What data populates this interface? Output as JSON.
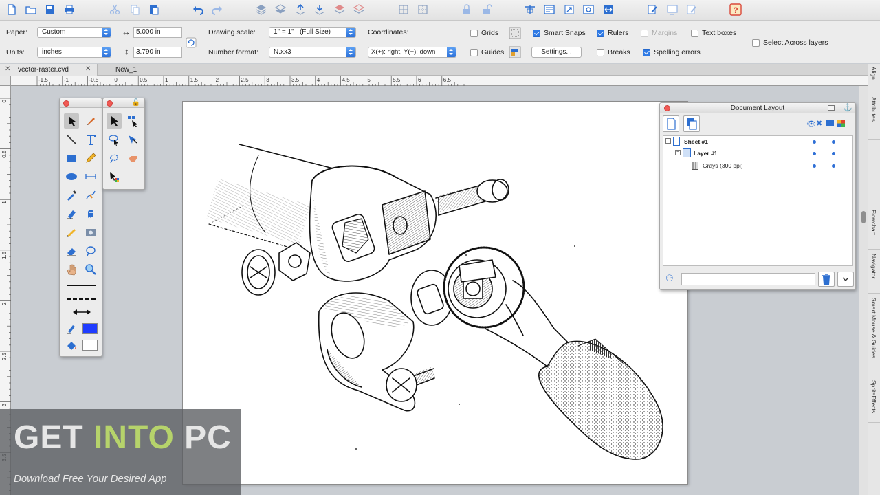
{
  "properties": {
    "paper_label": "Paper:",
    "paper_value": "Custom",
    "units_label": "Units:",
    "units_value": "inches",
    "width_value": "5.000 in",
    "height_value": "3.790 in",
    "drawing_scale_label": "Drawing scale:",
    "drawing_scale_value": "1\" = 1\"   (Full Size)",
    "number_format_label": "Number format:",
    "number_format_value": "N.xx3",
    "coordinates_label": "Coordinates:",
    "coordinates_value": "X(+): right, Y(+): down",
    "settings_button": "Settings...",
    "grids": "Grids",
    "guides": "Guides",
    "smart_snaps": "Smart Snaps",
    "rulers": "Rulers",
    "breaks": "Breaks",
    "margins": "Margins",
    "spelling_errors": "Spelling errors",
    "text_boxes": "Text boxes",
    "select_across_layers": "Select Across layers"
  },
  "tabs": [
    {
      "label": "vector-raster.cvd"
    },
    {
      "label": "New_1"
    }
  ],
  "ruler": {
    "h_labels": [
      "-1.5",
      "-1",
      "-0.5",
      "0",
      "0.5",
      "1",
      "1.5",
      "2",
      "2.5",
      "3",
      "3.5",
      "4",
      "4.5",
      "5",
      "5.5",
      "6",
      "6.5"
    ],
    "v_labels": [
      "0",
      "0.5",
      "1",
      "1.5",
      "2",
      "2.5",
      "3",
      "3.5"
    ]
  },
  "side_tabs": [
    "Align",
    "Attributes",
    "Flowchart",
    "Navigator",
    "Smart Mouse & Guides",
    "SpriteEffects"
  ],
  "doc_layout": {
    "title": "Document Layout",
    "sheet": "Sheet #1",
    "layer": "Layer #1",
    "image": "Grays (300 ppi)"
  },
  "watermark": {
    "part1": "GET ",
    "part2": "INTO",
    "part3": " PC",
    "tagline": "Download Free Your Desired App"
  },
  "colors": {
    "accent": "#2f7ae5",
    "watermark_green": "#b6d36b",
    "watermark_white": "#e6e6e6",
    "stroke_color": "#1f3cff"
  }
}
